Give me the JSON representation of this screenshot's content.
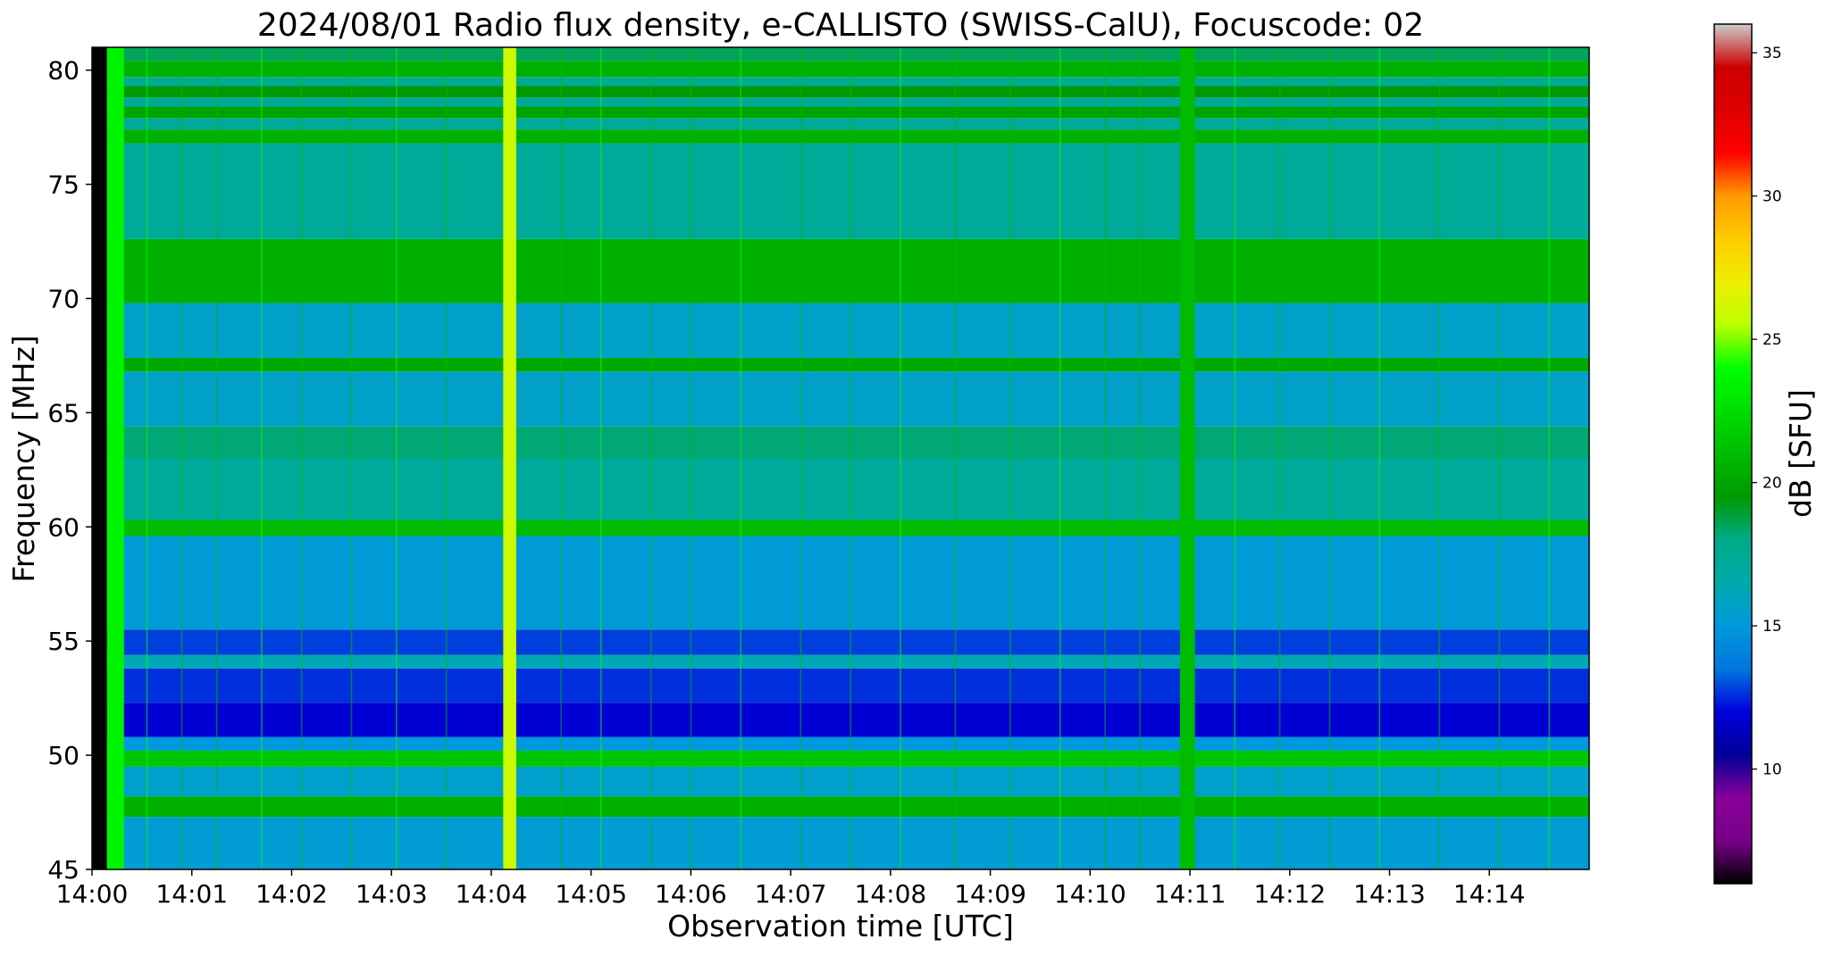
{
  "chart_data": {
    "type": "heatmap",
    "title": "2024/08/01  Radio flux density, e-CALLISTO (SWISS-CalU), Focuscode: 02",
    "xlabel": "Observation time [UTC]",
    "ylabel": "Frequency [MHz]",
    "colorbar_label": "dB [SFU]",
    "x_range_minutes": [
      0,
      15
    ],
    "x_ticks": [
      {
        "label": "14:00",
        "minute": 0
      },
      {
        "label": "14:01",
        "minute": 1
      },
      {
        "label": "14:02",
        "minute": 2
      },
      {
        "label": "14:03",
        "minute": 3
      },
      {
        "label": "14:04",
        "minute": 4
      },
      {
        "label": "14:05",
        "minute": 5
      },
      {
        "label": "14:06",
        "minute": 6
      },
      {
        "label": "14:07",
        "minute": 7
      },
      {
        "label": "14:08",
        "minute": 8
      },
      {
        "label": "14:09",
        "minute": 9
      },
      {
        "label": "14:10",
        "minute": 10
      },
      {
        "label": "14:11",
        "minute": 11
      },
      {
        "label": "14:12",
        "minute": 12
      },
      {
        "label": "14:13",
        "minute": 13
      },
      {
        "label": "14:14",
        "minute": 14
      }
    ],
    "y_range": [
      45,
      81
    ],
    "y_ticks": [
      45,
      50,
      55,
      60,
      65,
      70,
      75,
      80
    ],
    "colorbar_range": [
      6,
      36
    ],
    "colorbar_ticks": [
      10,
      15,
      20,
      25,
      30,
      35
    ],
    "colormap": "nipy_spectral",
    "background_dB": [
      {
        "from": 45,
        "to": 47.3,
        "dB": 15.3
      },
      {
        "from": 47.3,
        "to": 48.2,
        "dB": 20.5
      },
      {
        "from": 48.2,
        "to": 49.5,
        "dB": 15.5
      },
      {
        "from": 49.5,
        "to": 50.2,
        "dB": 21.5
      },
      {
        "from": 50.2,
        "to": 50.8,
        "dB": 15
      },
      {
        "from": 50.8,
        "to": 52.3,
        "dB": 11.8
      },
      {
        "from": 52.3,
        "to": 53.8,
        "dB": 12.6
      },
      {
        "from": 53.8,
        "to": 54.4,
        "dB": 16.2
      },
      {
        "from": 54.4,
        "to": 55.5,
        "dB": 12.8
      },
      {
        "from": 55.5,
        "to": 59.6,
        "dB": 15.2
      },
      {
        "from": 59.6,
        "to": 60.3,
        "dB": 21
      },
      {
        "from": 60.3,
        "to": 63,
        "dB": 17.2
      },
      {
        "from": 63,
        "to": 64.4,
        "dB": 18.2
      },
      {
        "from": 64.4,
        "to": 66.8,
        "dB": 15.6
      },
      {
        "from": 66.8,
        "to": 67.4,
        "dB": 20.2
      },
      {
        "from": 67.4,
        "to": 69.8,
        "dB": 15.6
      },
      {
        "from": 69.8,
        "to": 72.6,
        "dB": 20.5
      },
      {
        "from": 72.6,
        "to": 76.8,
        "dB": 17.3
      },
      {
        "from": 76.8,
        "to": 77.4,
        "dB": 20.5
      },
      {
        "from": 77.4,
        "to": 77.9,
        "dB": 17.3
      },
      {
        "from": 77.9,
        "to": 78.4,
        "dB": 20
      },
      {
        "from": 78.4,
        "to": 78.8,
        "dB": 17.3
      },
      {
        "from": 78.8,
        "to": 79.3,
        "dB": 19.5
      },
      {
        "from": 79.3,
        "to": 79.7,
        "dB": 17.5
      },
      {
        "from": 79.7,
        "to": 80.4,
        "dB": 20.5
      },
      {
        "from": 80.4,
        "to": 81,
        "dB": 18.5
      }
    ],
    "events_minute": [
      {
        "from": 0,
        "to": 0.15,
        "dB": 6
      },
      {
        "from": 0.15,
        "to": 0.32,
        "dB": 23.5
      },
      {
        "from": 4.12,
        "to": 4.25,
        "dB": 26
      },
      {
        "from": 10.9,
        "to": 11.05,
        "dB": 21
      }
    ],
    "spike_minutes": [
      0.55,
      0.9,
      1.25,
      1.7,
      2.1,
      2.6,
      3.05,
      3.55,
      4.7,
      5.1,
      5.6,
      6.0,
      6.5,
      7.1,
      7.6,
      8.1,
      8.65,
      9.2,
      9.7,
      10.15,
      10.5,
      11.45,
      11.9,
      12.4,
      12.9,
      13.5,
      14.1,
      14.6
    ]
  }
}
